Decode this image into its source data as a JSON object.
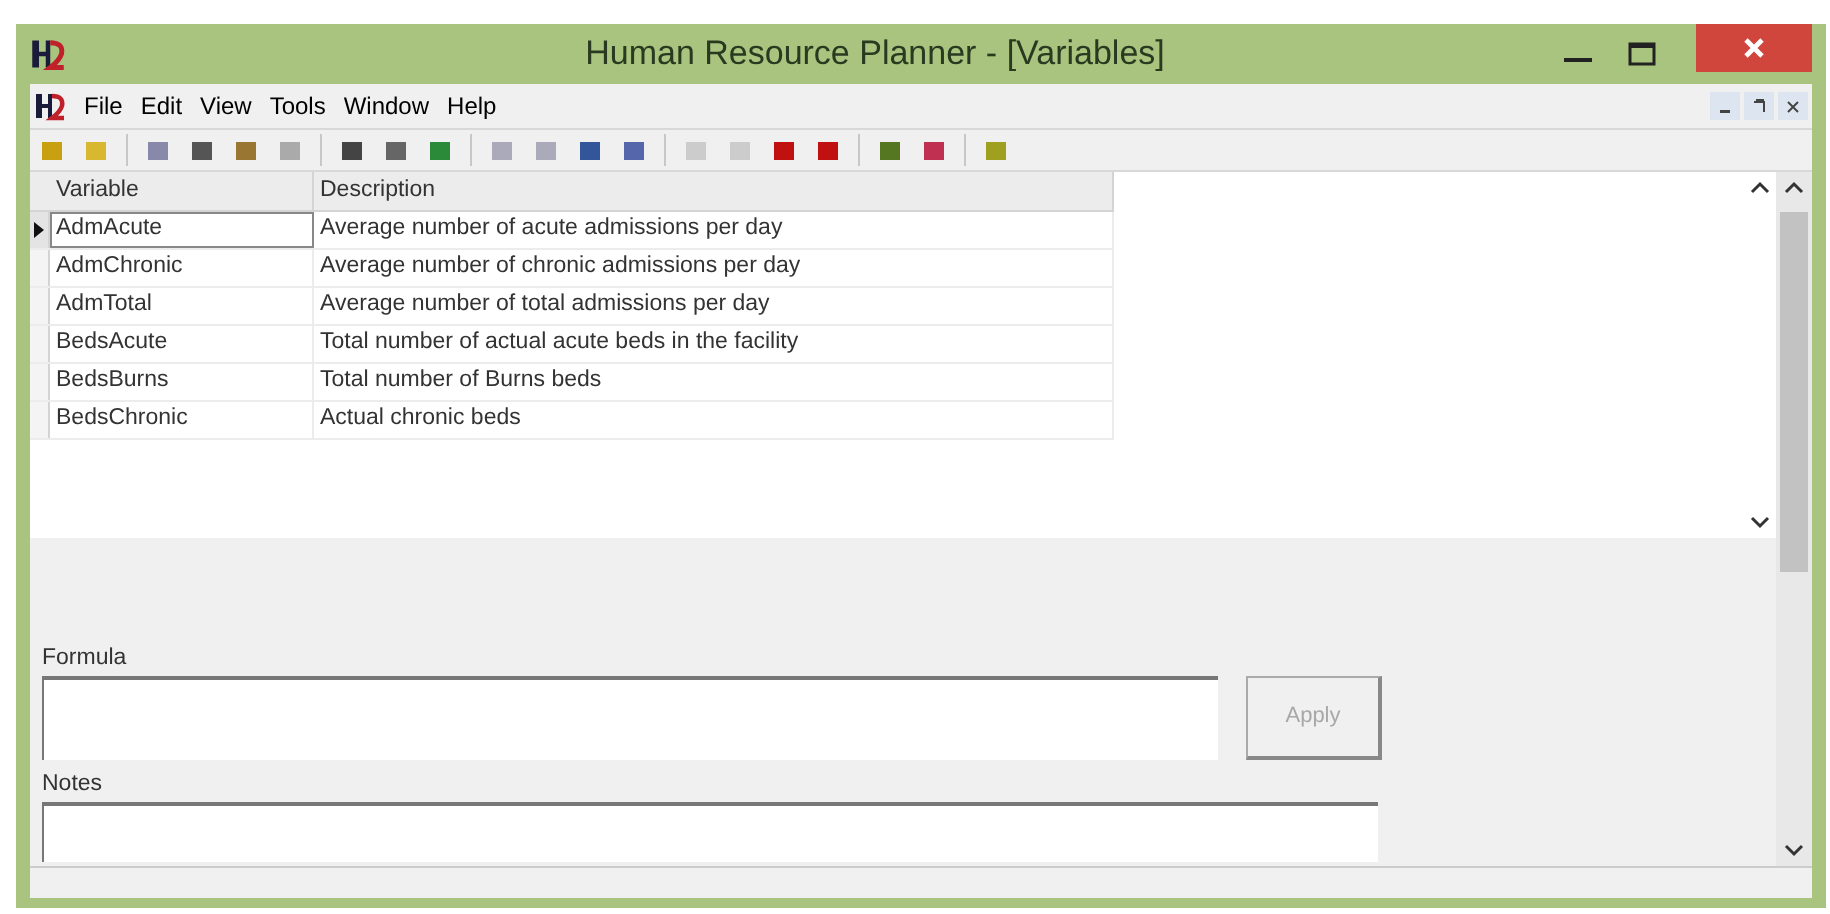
{
  "window": {
    "title": "Human Resource Planner - [Variables]"
  },
  "menu": [
    "File",
    "Edit",
    "View",
    "Tools",
    "Window",
    "Help"
  ],
  "table": {
    "columns": [
      "Variable",
      "Description"
    ],
    "rows": [
      {
        "cells": [
          "AdmAcute",
          "Average number of acute admissions per day"
        ],
        "selected": true
      },
      {
        "cells": [
          "AdmChronic",
          "Average number of chronic admissions per day"
        ],
        "selected": false
      },
      {
        "cells": [
          "AdmTotal",
          "Average number of total admissions per day"
        ],
        "selected": false
      },
      {
        "cells": [
          "BedsAcute",
          "Total number of actual acute beds in the facility"
        ],
        "selected": false
      },
      {
        "cells": [
          "BedsBurns",
          "Total number of Burns beds"
        ],
        "selected": false
      },
      {
        "cells": [
          "BedsChronic",
          "Actual chronic beds"
        ],
        "selected": false
      }
    ]
  },
  "formula": {
    "label": "Formula"
  },
  "apply_button": {
    "label": "Apply",
    "disabled": true
  },
  "notes": {
    "label": "Notes"
  }
}
